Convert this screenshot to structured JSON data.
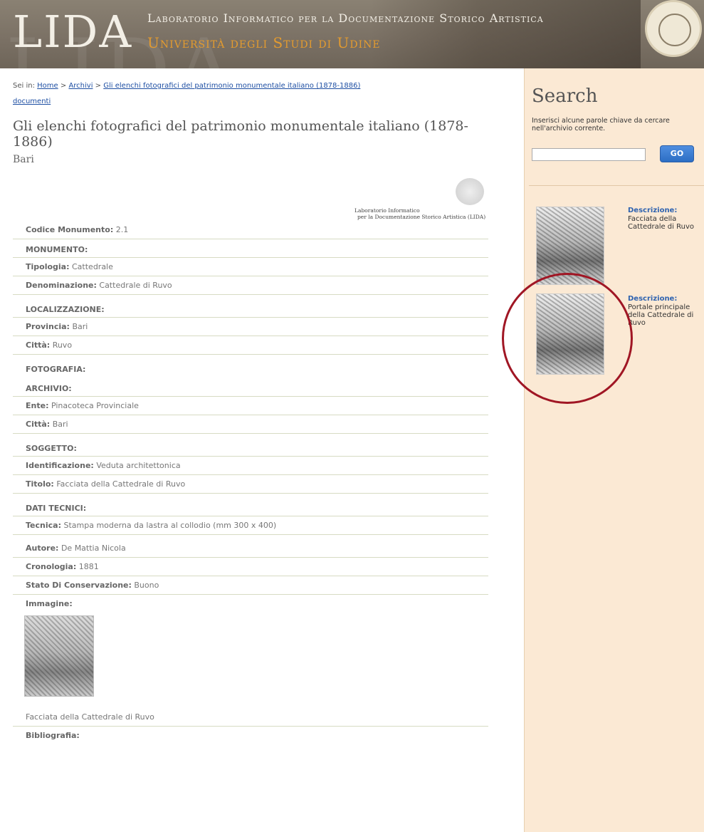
{
  "header": {
    "logo": "LIDA",
    "line1": "Laboratorio Informatico per la Documentazione Storico Artistica",
    "line2": "Università degli Studi di Udine"
  },
  "breadcrumb": {
    "prefix": "Sei in:",
    "home": "Home",
    "archivi": "Archivi",
    "collection": "Gli elenchi fotografici del patrimonio monumentale italiano (1878-1886)",
    "documenti": "documenti",
    "sep": ">"
  },
  "page": {
    "title": "Gli elenchi fotografici del patrimonio monumentale italiano (1878-1886)",
    "subtitle": "Bari"
  },
  "lida_note": {
    "line1": "Laboratorio Informatico",
    "line2": "per la Documentazione Storico Artistica (LIDA)"
  },
  "record": {
    "codice_label": "Codice Monumento:",
    "codice_value": "2.1",
    "monumento_section": "MONUMENTO:",
    "tipologia_label": "Tipologia:",
    "tipologia_value": "Cattedrale",
    "denominazione_label": "Denominazione:",
    "denominazione_value": "Cattedrale di Ruvo",
    "localizzazione_section": "LOCALIZZAZIONE:",
    "provincia_label": "Provincia:",
    "provincia_value": "Bari",
    "citta_label": "Città:",
    "citta_value": "Ruvo",
    "fotografia_section": "FOTOGRAFIA:",
    "archivio_section": "ARCHIVIO:",
    "ente_label": "Ente:",
    "ente_value": "Pinacoteca Provinciale",
    "citta2_label": "Città:",
    "citta2_value": "Bari",
    "soggetto_section": "SOGGETTO:",
    "identificazione_label": "Identificazione:",
    "identificazione_value": "Veduta architettonica",
    "titolo_label": "Titolo:",
    "titolo_value": "Facciata della Cattedrale di Ruvo",
    "dati_section": "DATI TECNICI:",
    "tecnica_label": "Tecnica:",
    "tecnica_value": "Stampa moderna da lastra al collodio (mm 300 x 400)",
    "autore_label": "Autore:",
    "autore_value": "De Mattia Nicola",
    "cronologia_label": "Cronologia:",
    "cronologia_value": "1881",
    "stato_label": "Stato Di Conservazione:",
    "stato_value": "Buono",
    "immagine_label": "Immagine:",
    "image_caption": "Facciata della Cattedrale di Ruvo",
    "bibliografia_label": "Bibliografia:"
  },
  "sidebar": {
    "search_title": "Search",
    "search_desc": "Inserisci alcune parole chiave da cercare nell'archivio corrente.",
    "search_placeholder": "",
    "go_label": "GO",
    "results": [
      {
        "label": "Descrizione:",
        "text": "Facciata della Cattedrale di Ruvo"
      },
      {
        "label": "Descrizione:",
        "text": "Portale principale della Cattedrale di Ruvo"
      }
    ]
  }
}
